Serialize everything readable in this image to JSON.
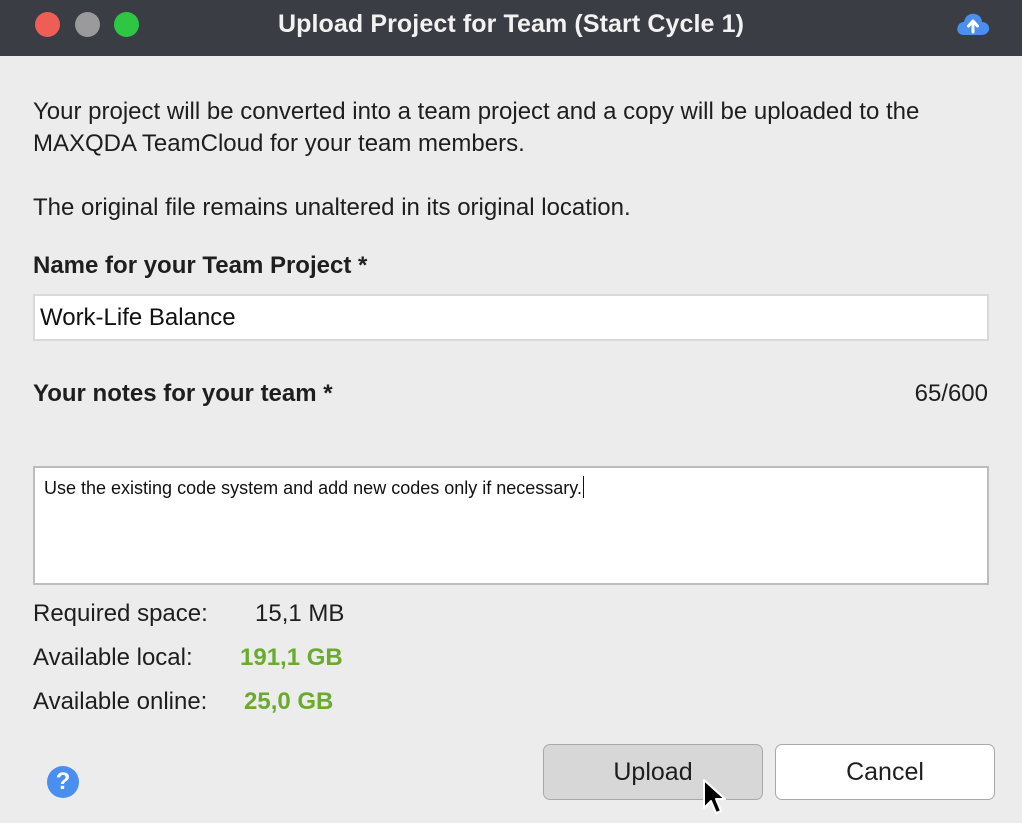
{
  "window": {
    "title": "Upload Project for Team (Start Cycle 1)"
  },
  "intro": {
    "paragraph1": "Your project will be converted into a team project and a copy will be uploaded to the MAXQDA TeamCloud for your team members.",
    "paragraph2": "The original file remains unaltered in its original location."
  },
  "project_name": {
    "label": "Name for your Team Project *",
    "value": "Work-Life Balance"
  },
  "notes": {
    "label": "Your notes for your team *",
    "counter": "65/600",
    "value": "Use the existing code system and add new codes only if necessary."
  },
  "storage": {
    "required_label": "Required space:",
    "required_value": "15,1 MB",
    "local_label": "Available local:",
    "local_value": "191,1 GB",
    "online_label": "Available online:",
    "online_value": "25,0 GB"
  },
  "buttons": {
    "help": "?",
    "upload": "Upload",
    "cancel": "Cancel"
  },
  "colors": {
    "accent_green": "#6aab2e",
    "help_blue": "#4a8ff0",
    "titlebar": "#3a3d43"
  },
  "icons": {
    "titlebar_right": "cloud-upload-icon",
    "pointer": "arrow-cursor-icon"
  }
}
